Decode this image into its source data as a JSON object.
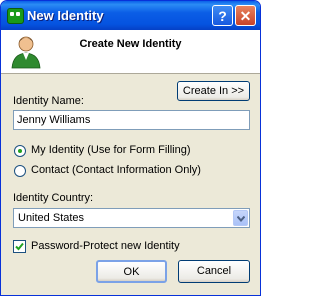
{
  "window": {
    "title": "New Identity"
  },
  "header": {
    "title": "Create New Identity"
  },
  "buttons": {
    "create_in": "Create In >>",
    "ok": "OK",
    "cancel": "Cancel"
  },
  "identity_name": {
    "label": "Identity Name:",
    "value": "Jenny Williams"
  },
  "identity_type": {
    "options": [
      {
        "label": "My Identity (Use for Form Filling)",
        "selected": true
      },
      {
        "label": "Contact (Contact Information Only)",
        "selected": false
      }
    ]
  },
  "identity_country": {
    "label": "Identity Country:",
    "selected": "United States"
  },
  "password_protect": {
    "label": "Password-Protect new Identity",
    "checked": true
  },
  "icons": [
    "app-icon",
    "help-icon",
    "close-icon",
    "person-icon",
    "dropdown-arrow-icon",
    "checkmark-icon"
  ],
  "colors": {
    "titlebar": "#0b5ee6",
    "dialog_bg": "#ece9d8",
    "close_button": "#c8432a",
    "radio_selected": "#21a121"
  }
}
